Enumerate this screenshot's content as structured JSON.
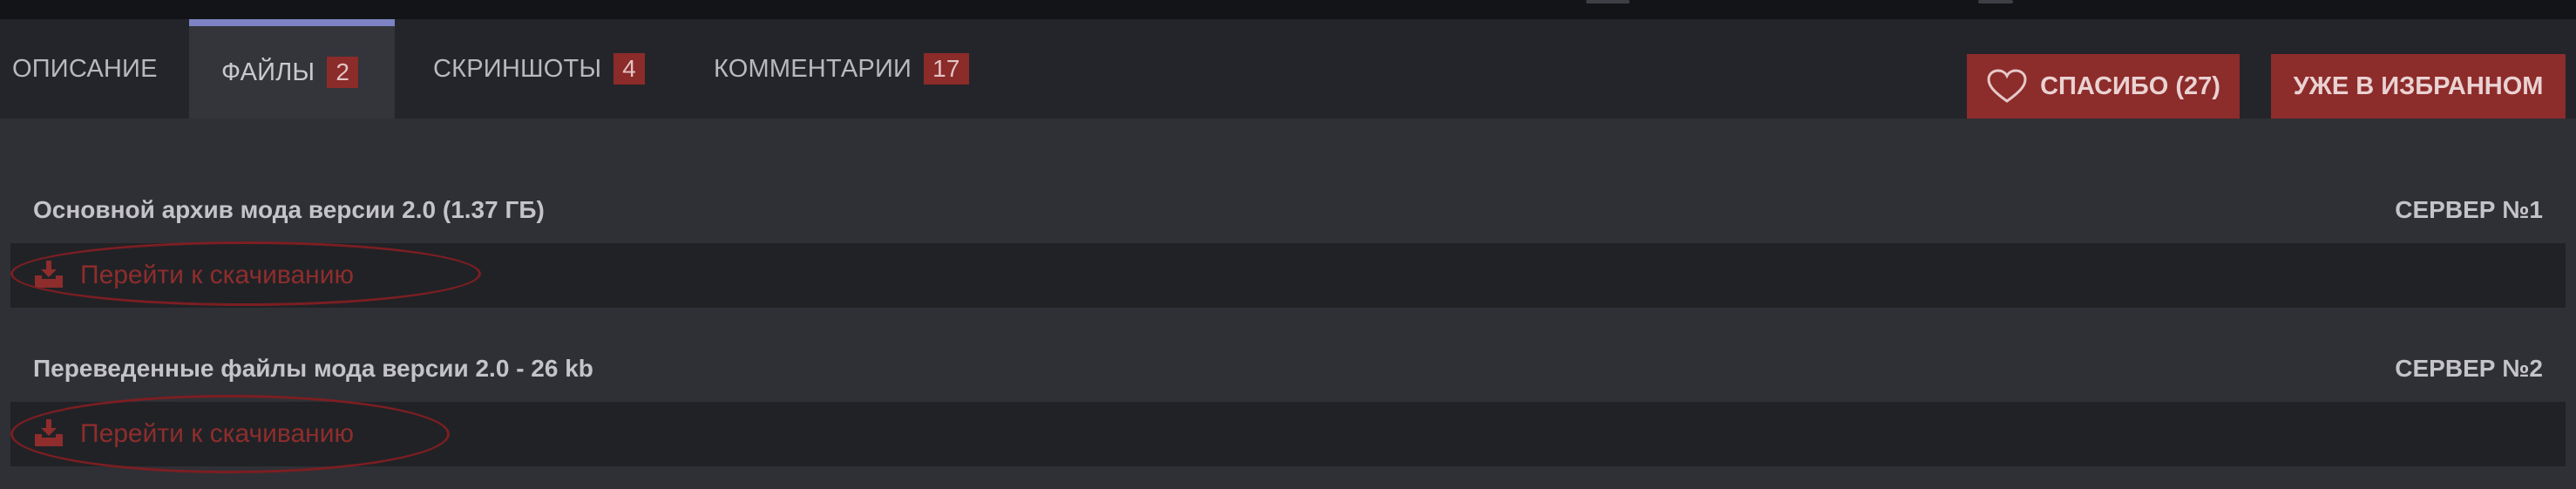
{
  "tabs": [
    {
      "label": "ОПИСАНИЕ",
      "count": null
    },
    {
      "label": "ФАЙЛЫ",
      "count": "2"
    },
    {
      "label": "СКРИНШОТЫ",
      "count": "4"
    },
    {
      "label": "КОММЕНТАРИИ",
      "count": "17"
    }
  ],
  "actions": {
    "thanks_label": "СПАСИБО (27)",
    "favorite_label": "УЖЕ В ИЗБРАННОМ"
  },
  "files": [
    {
      "title": "Основной архив мода версии 2.0 (1.37 ГБ)",
      "server": "СЕРВЕР №1",
      "link": "Перейти к скачиванию"
    },
    {
      "title": "Переведенные файлы мода версии 2.0 - 26 kb",
      "server": "СЕРВЕР №2",
      "link": "Перейти к скачиванию"
    }
  ],
  "colors": {
    "accent_red": "#8c2c2b",
    "active_tab_border": "#7d83c4",
    "annotation_ellipse": "#7c1e22"
  },
  "icons": [
    "heart-icon",
    "download-icon"
  ]
}
